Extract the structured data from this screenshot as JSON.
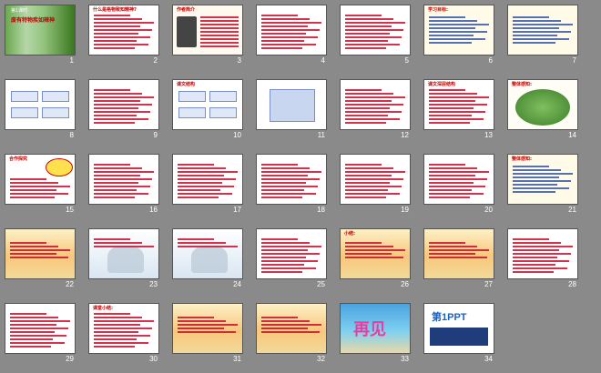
{
  "slides": [
    {
      "n": "1",
      "kind": "bamboo",
      "title": "第1课时",
      "subtitle": "废有特物疾如辣神"
    },
    {
      "n": "2",
      "kind": "text",
      "title": "什么是格物致知精神?"
    },
    {
      "n": "3",
      "kind": "portrait",
      "title": "作者简介"
    },
    {
      "n": "4",
      "kind": "text",
      "title": ""
    },
    {
      "n": "5",
      "kind": "text",
      "title": ""
    },
    {
      "n": "6",
      "kind": "list",
      "title": "学习目标:"
    },
    {
      "n": "7",
      "kind": "quiz",
      "title": ""
    },
    {
      "n": "8",
      "kind": "flow",
      "title": ""
    },
    {
      "n": "9",
      "kind": "text",
      "title": ""
    },
    {
      "n": "10",
      "kind": "outline",
      "title": "课文结构"
    },
    {
      "n": "11",
      "kind": "diagram",
      "title": ""
    },
    {
      "n": "12",
      "kind": "text",
      "title": ""
    },
    {
      "n": "13",
      "kind": "text",
      "title": "课文深层结构"
    },
    {
      "n": "14",
      "kind": "tree",
      "title": "整体感知:"
    },
    {
      "n": "15",
      "kind": "bubble",
      "title": "合作探究"
    },
    {
      "n": "16",
      "kind": "text",
      "title": ""
    },
    {
      "n": "17",
      "kind": "text",
      "title": ""
    },
    {
      "n": "18",
      "kind": "text",
      "title": ""
    },
    {
      "n": "19",
      "kind": "text",
      "title": ""
    },
    {
      "n": "20",
      "kind": "text",
      "title": ""
    },
    {
      "n": "21",
      "kind": "list",
      "title": "整体感知:"
    },
    {
      "n": "22",
      "kind": "sunset",
      "title": ""
    },
    {
      "n": "23",
      "kind": "winter",
      "title": ""
    },
    {
      "n": "24",
      "kind": "winter",
      "title": ""
    },
    {
      "n": "25",
      "kind": "text",
      "title": ""
    },
    {
      "n": "26",
      "kind": "sunset",
      "title": "小结:"
    },
    {
      "n": "27",
      "kind": "sunset",
      "title": ""
    },
    {
      "n": "28",
      "kind": "text",
      "title": ""
    },
    {
      "n": "29",
      "kind": "text",
      "title": ""
    },
    {
      "n": "30",
      "kind": "text",
      "title": "课堂小结:"
    },
    {
      "n": "31",
      "kind": "sunset",
      "title": ""
    },
    {
      "n": "32",
      "kind": "sunset",
      "title": ""
    },
    {
      "n": "33",
      "kind": "goodbye",
      "title": "再见"
    },
    {
      "n": "34",
      "kind": "ppt",
      "title": "第1PPT"
    }
  ]
}
